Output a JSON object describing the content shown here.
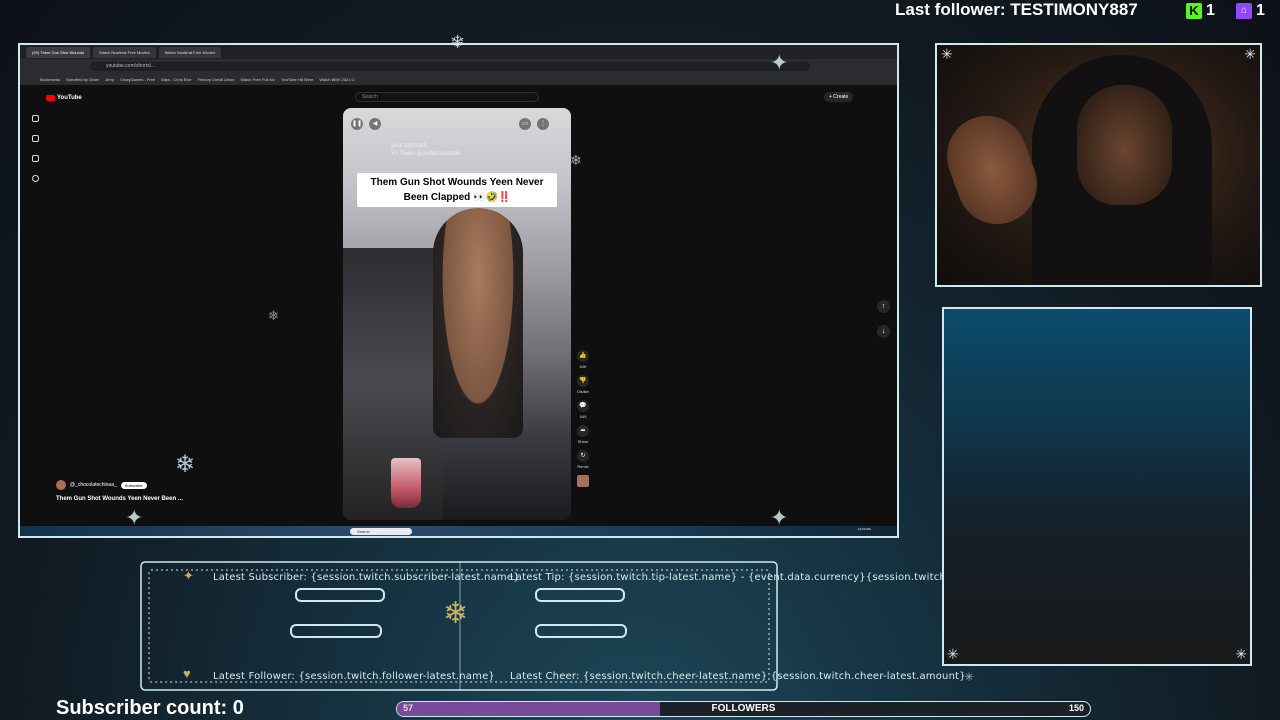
{
  "top": {
    "last_follower_label": "Last follower: TESTIMONY887",
    "kick_count": "1",
    "twitch_count": "1",
    "kick_logo": "K",
    "twitch_logo": "⌂"
  },
  "browser": {
    "tabs": [
      "(29) Them Gun Shot Wounds",
      "Watch Nosferat Free Movies",
      "Watch Nosferat Free Movies"
    ],
    "url": "youtube.com/shorts/...",
    "bookmarks": [
      "Bookmarks",
      "Specified by Order",
      "Jerry",
      "CrazyGames - Free",
      "Blips - Chris Elve",
      "Firstory Credit Union",
      "Watch Free Full Mo",
      "YouTube Hit Were",
      "Watch BMX 2021 O"
    ]
  },
  "youtube": {
    "logo": "YouTube",
    "search_placeholder": "Search",
    "create_label": "+ Create",
    "sidebar": [
      "Home",
      "Shorts",
      "Subscriptions",
      "You"
    ],
    "short_subtitle_1": "your stomach",
    "short_subtitle_2": ">> Them gunshot wounds",
    "short_caption": "Them Gun Shot Wounds Yeen Never Been Clapped 👀🤣‼️",
    "actions": [
      {
        "icon": "👍",
        "label": "44K"
      },
      {
        "icon": "👎",
        "label": "Dislike"
      },
      {
        "icon": "💬",
        "label": "549"
      },
      {
        "icon": "➦",
        "label": "Share"
      },
      {
        "icon": "↻",
        "label": "Remix"
      }
    ],
    "channel_name": "@_chocolatechinaa_",
    "subscribe_label": "Subscribe",
    "video_title": "Them Gun Shot Wounds Yeen Never Been ..."
  },
  "taskbar": {
    "search_label": "Search",
    "clock": "12:23 AM"
  },
  "alerts": {
    "latest_subscriber": "Latest Subscriber: {session.twitch.subscriber-latest.name}",
    "latest_tip": "Latest Tip: {session.twitch.tip-latest.name} - {event.data.currency}{session.twitch.tip-latest.amount}",
    "latest_follower": "Latest Follower: {session.twitch.follower-latest.name}",
    "latest_cheer": "Latest Cheer: {session.twitch.cheer-latest.name} {session.twitch.cheer-latest.amount}"
  },
  "bottom": {
    "subscriber_count": "Subscriber count: 0",
    "followers_label": "FOLLOWERS",
    "followers_current": "57",
    "followers_goal": "150",
    "followers_progress": 0.38
  },
  "colors": {
    "frame": "#cfe9ef",
    "twitch": "#9146ff",
    "kick": "#53fc18",
    "progress_fill": "#7a4a9a"
  }
}
